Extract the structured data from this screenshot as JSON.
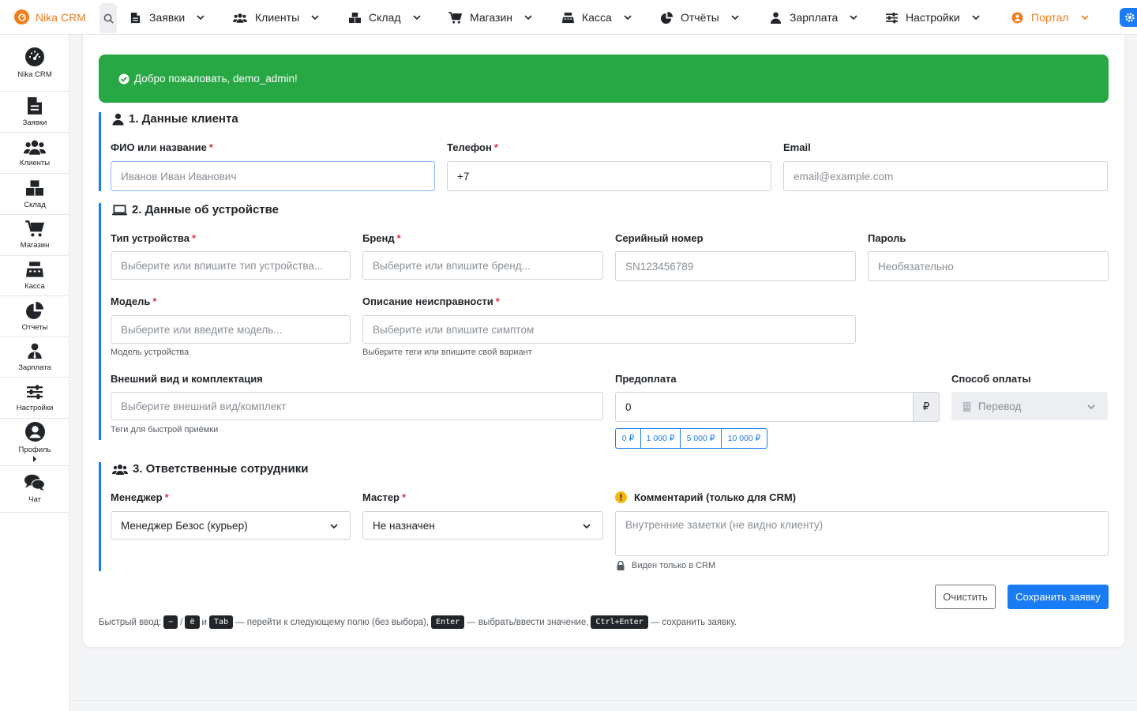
{
  "brand": {
    "name": "Nika CRM",
    "color": "#f07c1a"
  },
  "nav": {
    "items": [
      {
        "label": "Заявки",
        "icon": "document-icon"
      },
      {
        "label": "Клиенты",
        "icon": "users-icon"
      },
      {
        "label": "Склад",
        "icon": "boxes-icon"
      },
      {
        "label": "Магазин",
        "icon": "cart-icon"
      },
      {
        "label": "Касса",
        "icon": "cash-register-icon"
      },
      {
        "label": "Отчёты",
        "icon": "pie-chart-icon"
      },
      {
        "label": "Зарплата",
        "icon": "user-tie-icon"
      },
      {
        "label": "Настройки",
        "icon": "sliders-icon"
      },
      {
        "label": "Портал",
        "icon": "portal-icon"
      }
    ]
  },
  "sidebar": {
    "items": [
      {
        "label": "Nika CRM"
      },
      {
        "label": "Заявки"
      },
      {
        "label": "Клиенты"
      },
      {
        "label": "Склад"
      },
      {
        "label": "Магазин"
      },
      {
        "label": "Касса"
      },
      {
        "label": "Отчеты"
      },
      {
        "label": "Зарплата"
      },
      {
        "label": "Настройки"
      },
      {
        "label": "Профиль"
      },
      {
        "label": "Чат"
      }
    ]
  },
  "alert": {
    "text": "Добро пожаловать, demo_admin!"
  },
  "section1": {
    "title": "1. Данные клиента",
    "name_label": "ФИО или название",
    "name_placeholder": "Иванов Иван Иванович",
    "phone_label": "Телефон",
    "phone_value": "+7",
    "email_label": "Email",
    "email_placeholder": "email@example.com"
  },
  "section2": {
    "title": "2. Данные об устройстве",
    "type_label": "Тип устройства",
    "type_placeholder": "Выберите или впишите тип устройства...",
    "brand_label": "Бренд",
    "brand_placeholder": "Выберите или впишите бренд...",
    "serial_label": "Серийный номер",
    "serial_placeholder": "SN123456789",
    "password_label": "Пароль",
    "password_placeholder": "Необязательно",
    "model_label": "Модель",
    "model_placeholder": "Выберите или введите модель...",
    "model_hint": "Модель устройства",
    "fault_label": "Описание неисправности",
    "fault_placeholder": "Выберите или впишите симптом",
    "fault_hint": "Выберите теги или впишите свой вариант",
    "appearance_label": "Внешний вид и комплектация",
    "appearance_placeholder": "Выберите внешний вид/комплект",
    "appearance_hint": "Теги для быстрой приёмки",
    "prepay_label": "Предоплата",
    "prepay_value": "0",
    "currency": "₽",
    "quick_amounts": [
      "0 ₽",
      "1 000 ₽",
      "5 000 ₽",
      "10 000 ₽"
    ],
    "payment_label": "Способ оплаты",
    "payment_value": "Перевод"
  },
  "section3": {
    "title": "3. Ответственные сотрудники",
    "manager_label": "Менеджер",
    "manager_value": "Менеджер Безос (курьер)",
    "master_label": "Мастер",
    "master_value": "Не назначен",
    "comment_label": "Комментарий (только для CRM)",
    "comment_placeholder": "Внутренние заметки (не видно клиенту)",
    "comment_hint": "Виден только в CRM"
  },
  "actions": {
    "clear": "Очистить",
    "save": "Сохранить заявку"
  },
  "footer": {
    "prefix": "Быстрый ввод:",
    "key1": "~",
    "sep": "/",
    "key2": "ё",
    "and": "и",
    "key3": "Tab",
    "text1": "— перейти к следующему полю (без выбора),",
    "key4": "Enter",
    "text2": "— выбрать/ввести значение,",
    "key5": "Ctrl+Enter",
    "text3": "— сохранить заявку."
  },
  "colors": {
    "primary": "#1a7cf5",
    "success": "#28a745",
    "required": "#dc3545",
    "accent": "#f07c1a"
  }
}
